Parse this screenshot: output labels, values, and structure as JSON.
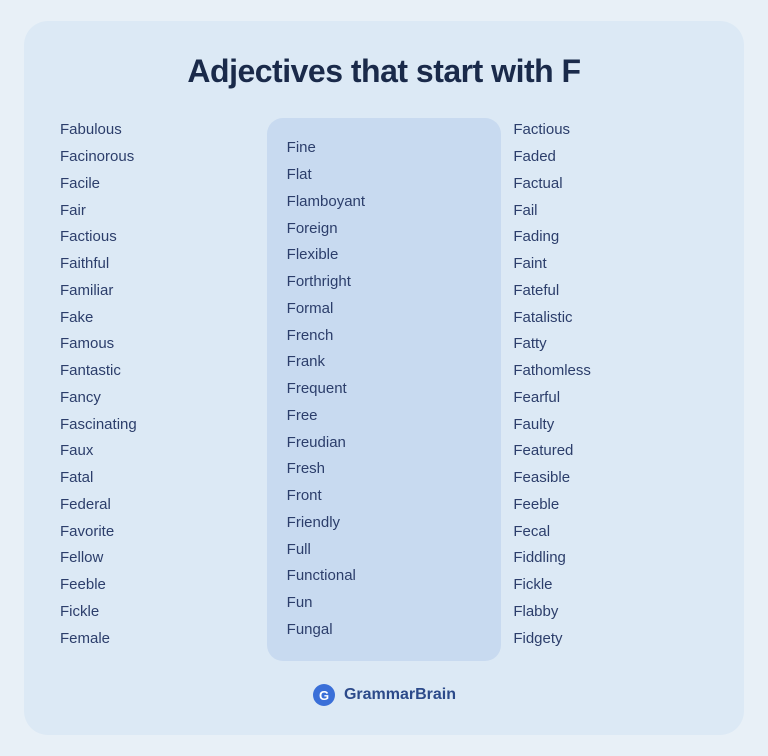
{
  "title": "Adjectives that start with F",
  "columns": {
    "left": [
      "Fabulous",
      "Facinorous",
      "Facile",
      "Fair",
      "Factious",
      "Faithful",
      "Familiar",
      "Fake",
      "Famous",
      "Fantastic",
      "Fancy",
      "Fascinating",
      "Faux",
      "Fatal",
      "Federal",
      "Favorite",
      "Fellow",
      "Feeble",
      "Fickle",
      "Female"
    ],
    "middle": [
      "Fine",
      "Flat",
      "Flamboyant",
      "Foreign",
      "Flexible",
      "Forthright",
      "Formal",
      "French",
      "Frank",
      "Frequent",
      "Free",
      "Freudian",
      "Fresh",
      "Front",
      "Friendly",
      "Full",
      "Functional",
      "Fun",
      "Fungal"
    ],
    "right": [
      "Factious",
      "Faded",
      "Factual",
      "Fail",
      "Fading",
      "Faint",
      "Fateful",
      "Fatalistic",
      "Fatty",
      "Fathomless",
      "Fearful",
      "Faulty",
      "Featured",
      "Feasible",
      "Feeble",
      "Fecal",
      "Fiddling",
      "Fickle",
      "Flabby",
      "Fidgety"
    ]
  },
  "footer": {
    "brand": "GrammarBrain"
  }
}
